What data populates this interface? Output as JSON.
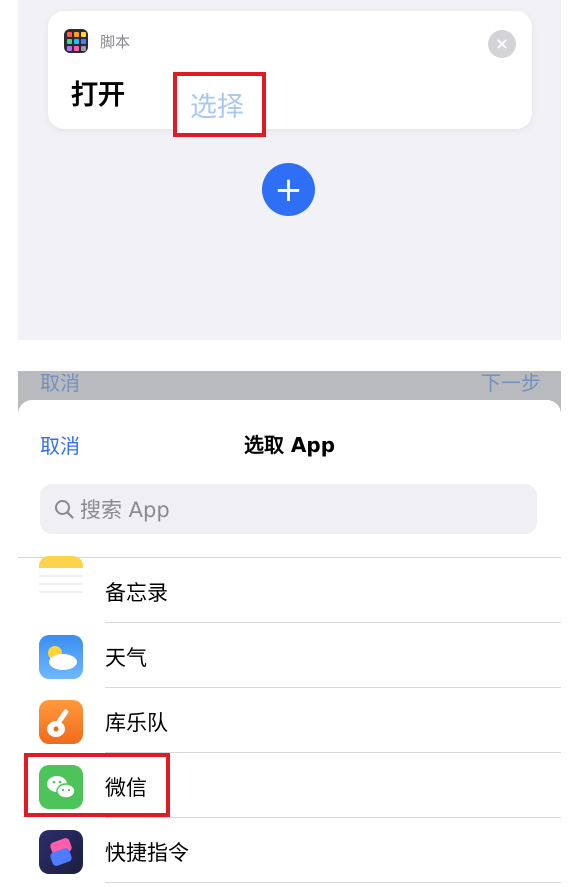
{
  "action_card": {
    "app_name": "脚本",
    "open_label": "打开",
    "select_label": "选择",
    "close_icon": "×"
  },
  "add_icon": "+",
  "backdrop": {
    "cancel": "取消",
    "next": "下一步"
  },
  "sheet": {
    "cancel": "取消",
    "title": "选取 App",
    "search_placeholder": "搜索 App"
  },
  "apps": [
    {
      "name": "备忘录",
      "icon": "notes-icon"
    },
    {
      "name": "天气",
      "icon": "weather-icon"
    },
    {
      "name": "库乐队",
      "icon": "garageband-icon"
    },
    {
      "name": "微信",
      "icon": "wechat-icon"
    },
    {
      "name": "快捷指令",
      "icon": "shortcuts-icon"
    }
  ],
  "colors": {
    "accent": "#2f6ff5",
    "highlight": "#e01b24"
  }
}
